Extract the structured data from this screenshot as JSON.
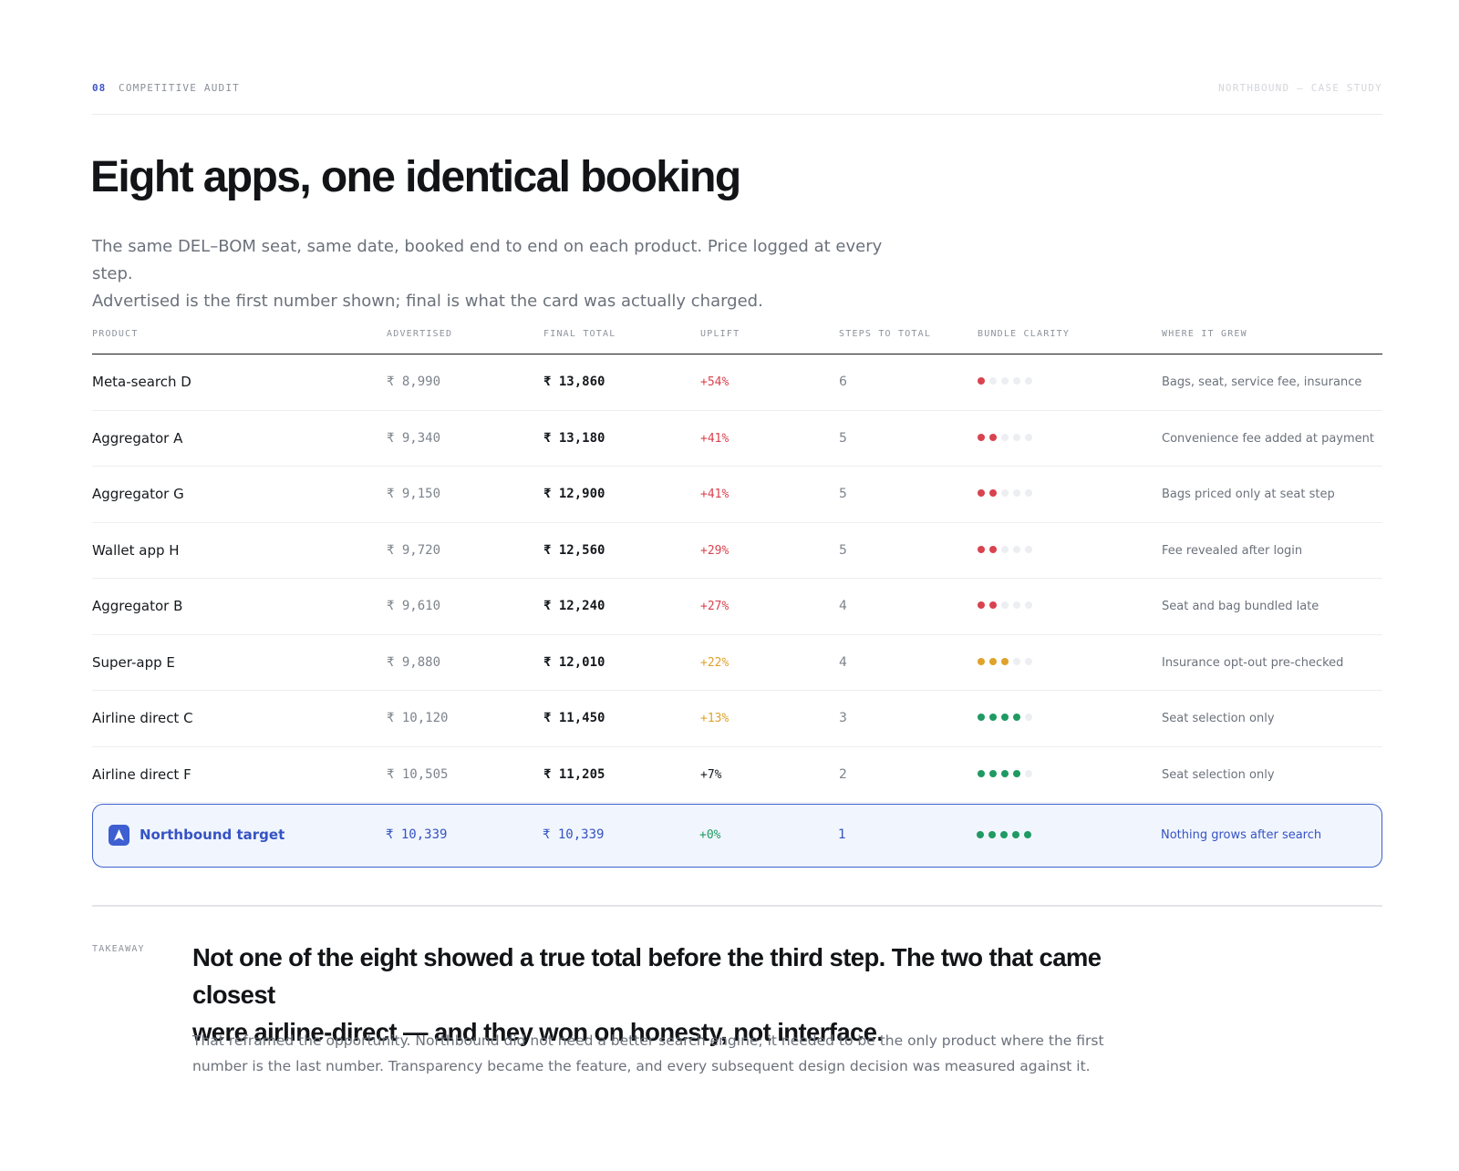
{
  "header": {
    "section_number": "08",
    "section_title": "COMPETITIVE AUDIT",
    "case_label": "NORTHBOUND — CASE STUDY"
  },
  "title": "Eight apps, one identical booking",
  "lead": {
    "line1": "The same DEL–BOM seat, same date, booked end to end on each product. Price logged at every step.",
    "line2": "Advertised is the first number shown; final is what the card was actually charged."
  },
  "table": {
    "columns": [
      "PRODUCT",
      "ADVERTISED",
      "FINAL TOTAL",
      "UPLIFT",
      "STEPS TO TOTAL",
      "BUNDLE CLARITY",
      "WHERE IT GREW"
    ],
    "rows": [
      {
        "product": "Meta-search D",
        "advertised": "₹ 8,990",
        "final": "₹ 13,860",
        "uplift": "+54%",
        "uplift_tone": "red",
        "steps": "6",
        "clarity": 1,
        "clarity_color": "#d9434e",
        "where": "Bags, seat, service fee, insurance"
      },
      {
        "product": "Aggregator A",
        "advertised": "₹ 9,340",
        "final": "₹ 13,180",
        "uplift": "+41%",
        "uplift_tone": "red",
        "steps": "5",
        "clarity": 2,
        "clarity_color": "#d9434e",
        "where": "Convenience fee added at payment"
      },
      {
        "product": "Aggregator G",
        "advertised": "₹ 9,150",
        "final": "₹ 12,900",
        "uplift": "+41%",
        "uplift_tone": "red",
        "steps": "5",
        "clarity": 2,
        "clarity_color": "#d9434e",
        "where": "Bags priced only at seat step"
      },
      {
        "product": "Wallet app H",
        "advertised": "₹ 9,720",
        "final": "₹ 12,560",
        "uplift": "+29%",
        "uplift_tone": "red",
        "steps": "5",
        "clarity": 2,
        "clarity_color": "#d9434e",
        "where": "Fee revealed after login"
      },
      {
        "product": "Aggregator B",
        "advertised": "₹ 9,610",
        "final": "₹ 12,240",
        "uplift": "+27%",
        "uplift_tone": "red",
        "steps": "4",
        "clarity": 2,
        "clarity_color": "#d9434e",
        "where": "Seat and bag bundled late"
      },
      {
        "product": "Super-app E",
        "advertised": "₹ 9,880",
        "final": "₹ 12,010",
        "uplift": "+22%",
        "uplift_tone": "amber",
        "steps": "4",
        "clarity": 3,
        "clarity_color": "#e0a22b",
        "where": "Insurance opt-out pre-checked"
      },
      {
        "product": "Airline direct C",
        "advertised": "₹ 10,120",
        "final": "₹ 11,450",
        "uplift": "+13%",
        "uplift_tone": "amber",
        "steps": "3",
        "clarity": 4,
        "clarity_color": "#1f9a63",
        "where": "Seat selection only"
      },
      {
        "product": "Airline direct F",
        "advertised": "₹ 10,505",
        "final": "₹ 11,205",
        "uplift": "+7%",
        "uplift_tone": "neutral",
        "steps": "2",
        "clarity": 4,
        "clarity_color": "#1f9a63",
        "where": "Seat selection only"
      }
    ],
    "clarity_max": 5,
    "target": {
      "product": "Northbound target",
      "advertised": "₹ 10,339",
      "final": "₹ 10,339",
      "uplift": "+0%",
      "uplift_tone": "green",
      "steps": "1",
      "clarity": 5,
      "clarity_color": "#1f9a63",
      "where": "Nothing grows after search",
      "logo_icon": "northbound-arrow-icon"
    }
  },
  "takeaway": {
    "label": "TAKEAWAY",
    "headline_line1": "Not one of the eight showed a true total before the third step. The two that came closest",
    "headline_line2": "were airline-direct — and they won on honesty, not interface.",
    "body_line1": "That reframed the opportunity. Northbound did not need a better search engine; it needed to be the only product where the first",
    "body_line2": "number is the last number. Transparency became the feature, and every subsequent design decision was measured against it."
  },
  "colors": {
    "accent": "#3d5fd1",
    "red": "#d9434e",
    "amber": "#e0a22b",
    "green": "#1f9a63"
  }
}
